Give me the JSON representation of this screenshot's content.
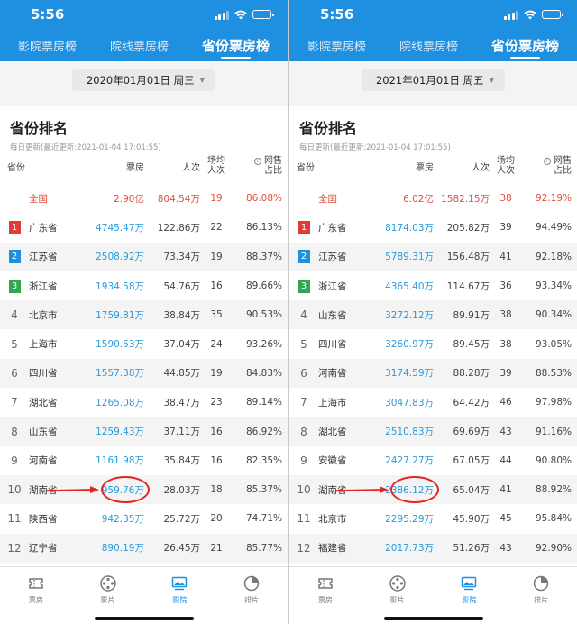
{
  "screens": [
    {
      "time": "5:56",
      "tabs": [
        "影院票房榜",
        "院线票房榜",
        "省份票房榜"
      ],
      "active_tab": 2,
      "date": "2020年01月01日 周三",
      "section_title": "省份排名",
      "update_text": "每日更新(最近更新:2021-01-04 17:01:55)",
      "headers": {
        "province": "省份",
        "boxoffice": "票房",
        "audience": "人次",
        "shows_line1": "场均",
        "shows_line2": "人次",
        "online_line1": "网售",
        "online_line2": "占比"
      },
      "total": {
        "name": "全国",
        "box": "2.90亿",
        "aud": "804.54万",
        "shows": "19",
        "pct": "86.08%"
      },
      "rows": [
        {
          "rank": "1",
          "name": "广东省",
          "box": "4745.47万",
          "aud": "122.86万",
          "shows": "22",
          "pct": "86.13%"
        },
        {
          "rank": "2",
          "name": "江苏省",
          "box": "2508.92万",
          "aud": "73.34万",
          "shows": "19",
          "pct": "88.37%"
        },
        {
          "rank": "3",
          "name": "浙江省",
          "box": "1934.58万",
          "aud": "54.76万",
          "shows": "16",
          "pct": "89.66%"
        },
        {
          "rank": "4",
          "name": "北京市",
          "box": "1759.81万",
          "aud": "38.84万",
          "shows": "35",
          "pct": "90.53%"
        },
        {
          "rank": "5",
          "name": "上海市",
          "box": "1590.53万",
          "aud": "37.04万",
          "shows": "24",
          "pct": "93.26%"
        },
        {
          "rank": "6",
          "name": "四川省",
          "box": "1557.38万",
          "aud": "44.85万",
          "shows": "19",
          "pct": "84.83%"
        },
        {
          "rank": "7",
          "name": "湖北省",
          "box": "1265.08万",
          "aud": "38.47万",
          "shows": "23",
          "pct": "89.14%"
        },
        {
          "rank": "8",
          "name": "山东省",
          "box": "1259.43万",
          "aud": "37.11万",
          "shows": "16",
          "pct": "86.92%"
        },
        {
          "rank": "9",
          "name": "河南省",
          "box": "1161.98万",
          "aud": "35.84万",
          "shows": "16",
          "pct": "82.35%"
        },
        {
          "rank": "10",
          "name": "湖南省",
          "box": "959.76万",
          "aud": "28.03万",
          "shows": "18",
          "pct": "85.37%"
        },
        {
          "rank": "11",
          "name": "陕西省",
          "box": "942.35万",
          "aud": "25.72万",
          "shows": "20",
          "pct": "74.71%"
        },
        {
          "rank": "12",
          "name": "辽宁省",
          "box": "890.19万",
          "aud": "26.45万",
          "shows": "21",
          "pct": "85.77%"
        }
      ],
      "nav": [
        "票房",
        "影片",
        "影院",
        "排片"
      ],
      "active_nav": 2
    },
    {
      "time": "5:56",
      "tabs": [
        "影院票房榜",
        "院线票房榜",
        "省份票房榜"
      ],
      "active_tab": 2,
      "date": "2021年01月01日 周五",
      "section_title": "省份排名",
      "update_text": "每日更新(最近更新:2021-01-04 17:01:55)",
      "headers": {
        "province": "省份",
        "boxoffice": "票房",
        "audience": "人次",
        "shows_line1": "场均",
        "shows_line2": "人次",
        "online_line1": "网售",
        "online_line2": "占比"
      },
      "total": {
        "name": "全国",
        "box": "6.02亿",
        "aud": "1582.15万",
        "shows": "38",
        "pct": "92.19%"
      },
      "rows": [
        {
          "rank": "1",
          "name": "广东省",
          "box": "8174.03万",
          "aud": "205.82万",
          "shows": "39",
          "pct": "94.49%"
        },
        {
          "rank": "2",
          "name": "江苏省",
          "box": "5789.31万",
          "aud": "156.48万",
          "shows": "41",
          "pct": "92.18%"
        },
        {
          "rank": "3",
          "name": "浙江省",
          "box": "4365.40万",
          "aud": "114.67万",
          "shows": "36",
          "pct": "93.34%"
        },
        {
          "rank": "4",
          "name": "山东省",
          "box": "3272.12万",
          "aud": "89.91万",
          "shows": "38",
          "pct": "90.34%"
        },
        {
          "rank": "5",
          "name": "四川省",
          "box": "3260.97万",
          "aud": "89.45万",
          "shows": "38",
          "pct": "93.05%"
        },
        {
          "rank": "6",
          "name": "河南省",
          "box": "3174.59万",
          "aud": "88.28万",
          "shows": "39",
          "pct": "88.53%"
        },
        {
          "rank": "7",
          "name": "上海市",
          "box": "3047.83万",
          "aud": "64.42万",
          "shows": "46",
          "pct": "97.98%"
        },
        {
          "rank": "8",
          "name": "湖北省",
          "box": "2510.83万",
          "aud": "69.69万",
          "shows": "43",
          "pct": "91.16%"
        },
        {
          "rank": "9",
          "name": "安徽省",
          "box": "2427.27万",
          "aud": "67.05万",
          "shows": "44",
          "pct": "90.80%"
        },
        {
          "rank": "10",
          "name": "湖南省",
          "box": "2386.12万",
          "aud": "65.04万",
          "shows": "41",
          "pct": "88.92%"
        },
        {
          "rank": "11",
          "name": "北京市",
          "box": "2295.29万",
          "aud": "45.90万",
          "shows": "45",
          "pct": "95.84%"
        },
        {
          "rank": "12",
          "name": "福建省",
          "box": "2017.73万",
          "aud": "51.26万",
          "shows": "43",
          "pct": "92.90%"
        }
      ],
      "nav": [
        "票房",
        "影片",
        "影院",
        "排片"
      ],
      "active_nav": 2
    }
  ],
  "highlight_row_index": 9,
  "colors": {
    "header_blue": "#1f8fe0",
    "total_red": "#e0503f",
    "rank1": "#e03b3b",
    "rank2": "#1f8fe0",
    "rank3": "#2fa84f",
    "box_blue": "#2a9ad8",
    "annotation_red": "#e02525"
  }
}
